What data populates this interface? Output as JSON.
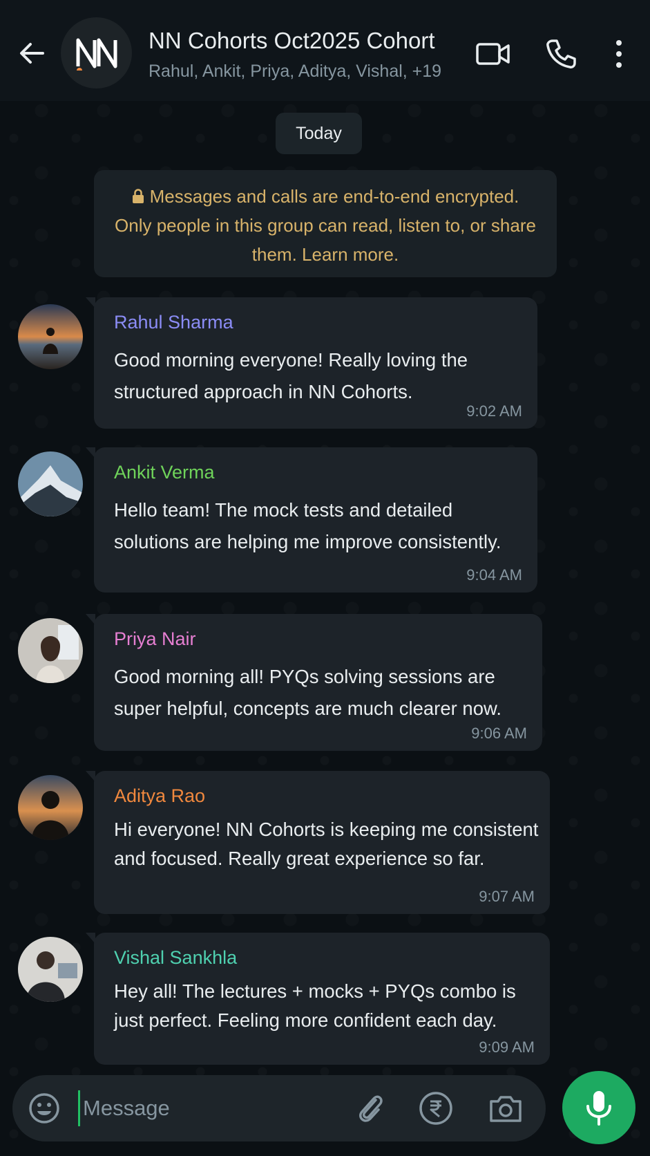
{
  "header": {
    "title": "NN Cohorts Oct2025 Cohort",
    "members": "Rahul, Ankit, Priya, Aditya, Vishal, +19",
    "avatar_text": "NN"
  },
  "date_chip": "Today",
  "encryption_notice": "Messages and calls are end-to-end encrypted. Only people in this group can read, listen to, or share them. Learn more.",
  "messages": [
    {
      "sender": "Rahul Sharma",
      "color": "#8b8cf5",
      "text": "Good morning everyone! Really loving the structured approach in NN Cohorts.",
      "time": "9:02 AM"
    },
    {
      "sender": "Ankit Verma",
      "color": "#6fd35a",
      "text": "Hello team! The mock tests and detailed solutions are helping me improve consistently.",
      "time": "9:04 AM"
    },
    {
      "sender": "Priya Nair",
      "color": "#e67fd2",
      "text": "Good morning all! PYQs solving sessions are super helpful, concepts are much clearer now.",
      "time": "9:06 AM"
    },
    {
      "sender": "Aditya Rao",
      "color": "#f0883e",
      "text": "Hi everyone! NN Cohorts is keeping me consistent and focused. Really great experience so far.",
      "time": "9:07 AM"
    },
    {
      "sender": "Vishal Sankhla",
      "color": "#4fd1b0",
      "text": "Hey all! The lectures + mocks + PYQs combo is just perfect. Feeling more confident each day.",
      "time": "9:09 AM"
    }
  ],
  "composer": {
    "placeholder": "Message",
    "value": ""
  },
  "colors": {
    "accent_green": "#1daa61",
    "header_bg": "#0f151a",
    "bubble_bg": "#1d2329",
    "encryption_text": "#d8b36a"
  },
  "icons": [
    "back-arrow-icon",
    "video-call-icon",
    "phone-icon",
    "more-options-icon",
    "lock-icon",
    "emoji-icon",
    "attach-icon",
    "rupee-icon",
    "camera-icon",
    "mic-icon"
  ]
}
